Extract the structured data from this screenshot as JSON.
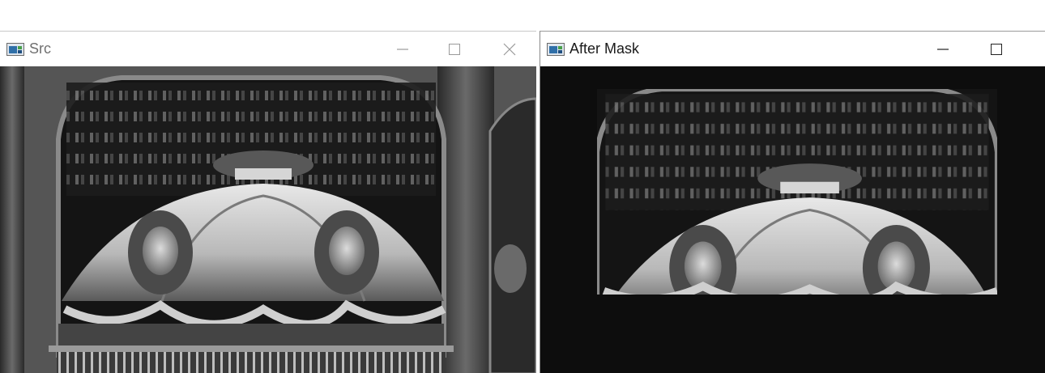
{
  "windows": {
    "src": {
      "title": "Src",
      "icon": "opencv-window-icon"
    },
    "mask": {
      "title": "After Mask",
      "icon": "opencv-window-icon"
    }
  },
  "colors": {
    "titlebar_bg": "#ffffff",
    "mask_background": "#0d0d0d"
  }
}
